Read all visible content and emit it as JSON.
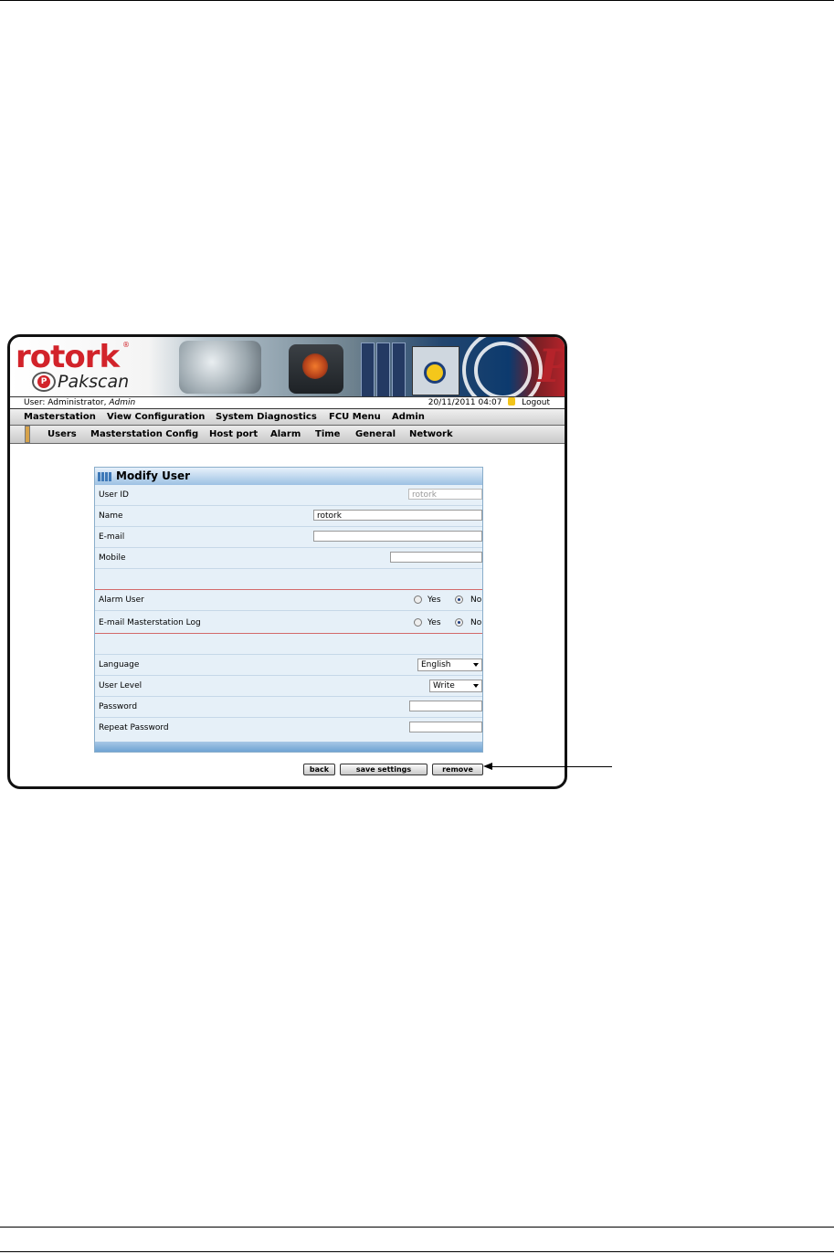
{
  "header": {
    "brand": "rotork",
    "registered_mark": "®",
    "product": "Pakscan",
    "product_badge": "P",
    "version_mark": "P",
    "user_prefix": "User: Administrator, ",
    "user_role": "Admin",
    "datetime": "20/11/2011 04:07",
    "logout": "Logout"
  },
  "menu": [
    "Masterstation",
    "View Configuration",
    "System Diagnostics",
    "FCU Menu",
    "Admin"
  ],
  "submenu": [
    "Users",
    "Masterstation Config",
    "Host port",
    "Alarm",
    "Time",
    "General",
    "Network"
  ],
  "form": {
    "title": "Modify User",
    "fields": {
      "user_id_label": "User ID",
      "user_id_value": "rotork",
      "name_label": "Name",
      "name_value": "rotork",
      "email_label": "E-mail",
      "email_value": "",
      "mobile_label": "Mobile",
      "mobile_value": "",
      "alarm_user_label": "Alarm User",
      "email_log_label": "E-mail Masterstation Log",
      "yes": "Yes",
      "no": "No",
      "language_label": "Language",
      "language_value": "English",
      "user_level_label": "User Level",
      "user_level_value": "Write",
      "password_label": "Password",
      "password_value": "",
      "repeat_password_label": "Repeat Password",
      "repeat_password_value": ""
    },
    "alarm_user_selected": "No",
    "email_log_selected": "No"
  },
  "buttons": {
    "back": "back",
    "save": "save settings",
    "remove": "remove"
  },
  "colors": {
    "brand_red": "#d2232a",
    "panel_blue": "#e6f0f8",
    "divider_red": "#d36a6a"
  }
}
